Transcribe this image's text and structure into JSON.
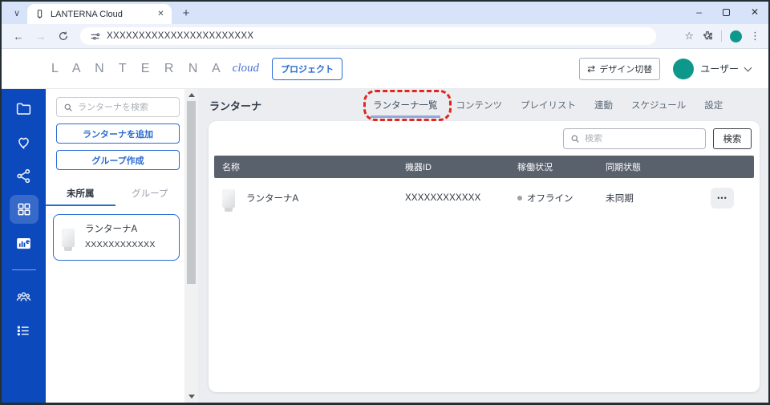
{
  "browser": {
    "tab_title": "LANTERNA Cloud",
    "url": "XXXXXXXXXXXXXXXXXXXXXXX"
  },
  "icons": {
    "chevron_down": "∨",
    "plus": "+",
    "minimize": "–",
    "close": "✕",
    "tab_close": "✕",
    "back": "←",
    "forward": "→",
    "star": "☆",
    "more_vertical": "⋮",
    "swap": "⇄",
    "ellipsis": "•••"
  },
  "header": {
    "logo_main": "L A N T E R N A",
    "logo_sub": "cloud",
    "project_button": "プロジェクト",
    "design_switch_button": "デザイン切替",
    "user_label": "ユーザー"
  },
  "left_panel": {
    "search_placeholder": "ランターナを検索",
    "add_button": "ランターナを追加",
    "create_group_button": "グループ作成",
    "tabs": [
      {
        "label": "未所属",
        "active": true
      },
      {
        "label": "グループ",
        "active": false
      }
    ],
    "device": {
      "name": "ランターナA",
      "id": "XXXXXXXXXXXX"
    }
  },
  "main": {
    "title": "ランターナ",
    "tabs": [
      "ランターナ一覧",
      "コンテンツ",
      "プレイリスト",
      "連動",
      "スケジュール",
      "設定"
    ],
    "active_tab_index": 0,
    "highlight": {
      "target": "ランターナ一覧",
      "style": "red-dashed-box"
    },
    "search_placeholder": "検索",
    "search_button": "検索",
    "table": {
      "columns": [
        "名称",
        "機器ID",
        "稼働状況",
        "同期状態"
      ],
      "rows": [
        {
          "name": "ランターナA",
          "device_id": "XXXXXXXXXXXX",
          "status": "オフライン",
          "sync": "未同期"
        }
      ]
    }
  },
  "colors": {
    "accent": "#2a6bd2",
    "rail": "#0c49bd",
    "teal": "#0e988b",
    "red": "#e0261f",
    "thead": "#59616c",
    "dot": "#9aa3ab"
  }
}
